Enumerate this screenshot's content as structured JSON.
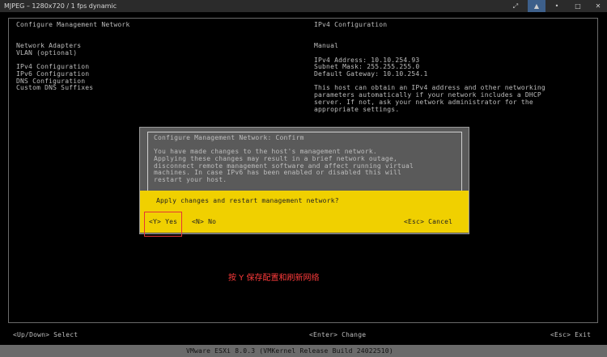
{
  "window": {
    "title": "MJPEG – 1280x720 / 1 fps dynamic",
    "controls": [
      "⤢",
      "▲",
      "•",
      "□",
      "✕"
    ]
  },
  "left_panel": {
    "header": "Configure Management Network",
    "items": [
      "Network Adapters",
      "VLAN (optional)",
      "IPv4 Configuration",
      "IPv6 Configuration",
      "DNS Configuration",
      "Custom DNS Suffixes"
    ]
  },
  "right_panel": {
    "header": "IPv4 Configuration",
    "mode": "Manual",
    "address_line": "IPv4 Address: 10.10.254.93",
    "subnet_line": "Subnet Mask: 255.255.255.0",
    "gateway_line": "Default Gateway: 10.10.254.1",
    "help_lines": [
      "This host can obtain an IPv4 address and other networking",
      "parameters automatically if your network includes a DHCP",
      "server. If not, ask your network administrator for the",
      "appropriate settings."
    ]
  },
  "dialog": {
    "title": "Configure Management Network: Confirm",
    "body_lines": [
      "You have made changes to the host's management network.",
      "Applying these changes may result in a brief network outage,",
      "disconnect remote management software and affect running virtual",
      "machines. In case IPv6 has been enabled or disabled this will",
      "restart your host."
    ],
    "question": "Apply changes and restart management network?",
    "yes_label": "<Y> Yes",
    "no_label": "<N> No",
    "cancel_label": "<Esc> Cancel"
  },
  "annotation": "按 Y 保存配置和刷新网络",
  "bottom_bar": {
    "left": "<Up/Down> Select",
    "center": "<Enter> Change",
    "right": "<Esc> Exit"
  },
  "footer": "VMware ESXi 8.0.3 (VMKernel Release Build 24022510)",
  "colors": {
    "background": "#000000",
    "dialog": "#5a5a5a",
    "prompt": "#f0d000",
    "highlight": "#e53535"
  }
}
